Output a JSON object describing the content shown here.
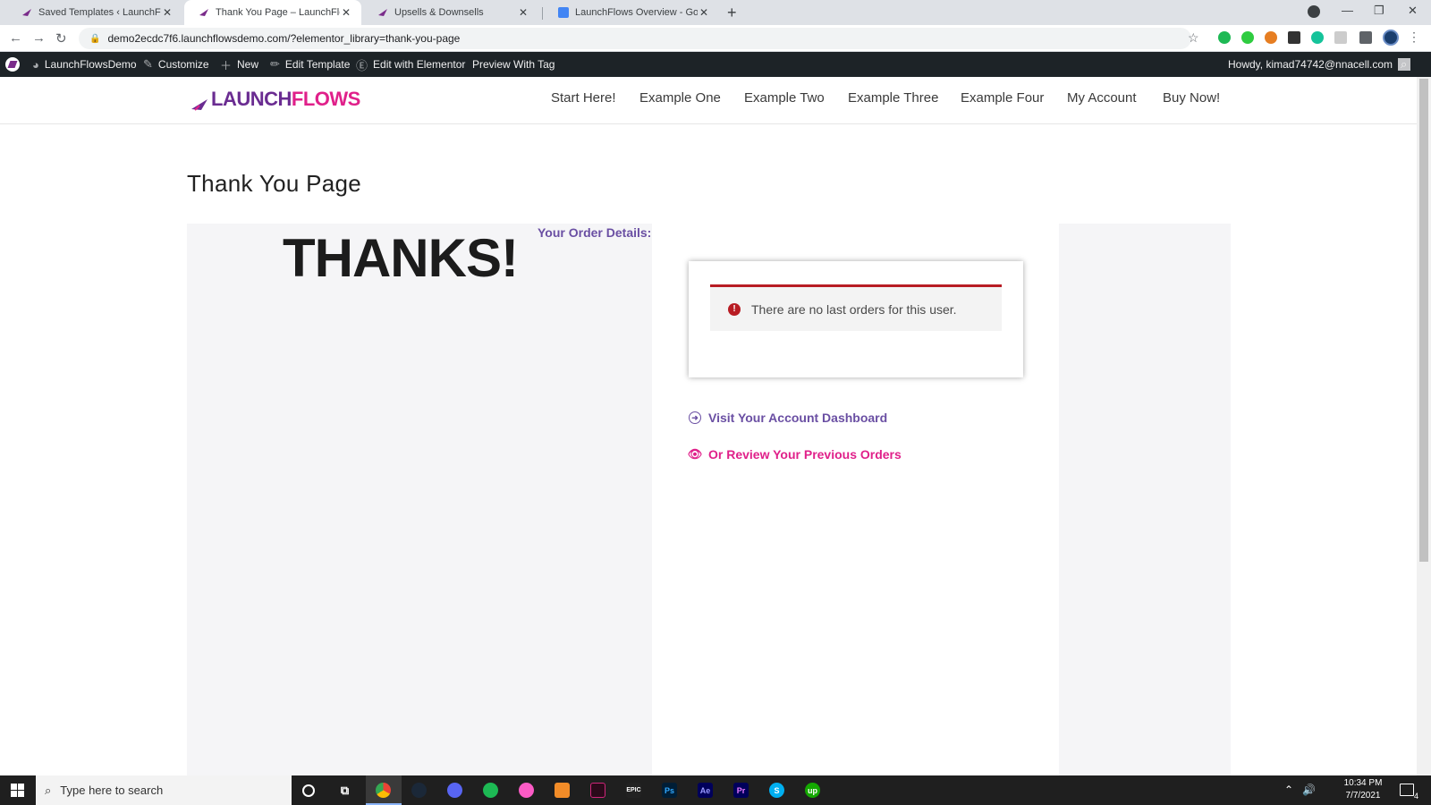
{
  "browser": {
    "tabs": [
      {
        "title": "Saved Templates ‹ LaunchFlowsD",
        "active": false
      },
      {
        "title": "Thank You Page – LaunchFlowsD",
        "active": true
      },
      {
        "title": "Upsells & Downsells",
        "active": false
      },
      {
        "title": "LaunchFlows Overview - Google",
        "active": false
      }
    ],
    "url": "demo2ecdc7f6.launchflowsdemo.com/?elementor_library=thank-you-page"
  },
  "wp_admin_bar": {
    "site_name": "LaunchFlowsDemo",
    "customize": "Customize",
    "new": "New",
    "edit_template": "Edit Template",
    "edit_elementor": "Edit with Elementor",
    "preview": "Preview With Tag",
    "howdy": "Howdy, kimad74742@nnacell.com"
  },
  "site": {
    "logo_part1": "LAUNCH",
    "logo_part2": "FLOWS",
    "nav": [
      "Start Here!",
      "Example One",
      "Example Two",
      "Example Three",
      "Example Four",
      "My Account",
      "Buy Now!"
    ]
  },
  "page": {
    "title": "Thank You Page",
    "thanks_heading": "THANKS!",
    "order_details_label": "Your Order Details:",
    "notice_text": "There are no last orders for this user.",
    "link_dashboard": "Visit Your Account Dashboard",
    "link_orders": "Or Review Your Previous Orders"
  },
  "taskbar": {
    "search_placeholder": "Type here to search",
    "time": "10:34 PM",
    "date": "7/7/2021",
    "notification_count": "4"
  },
  "colors": {
    "brand_purple": "#6a2c91",
    "brand_pink": "#e0208a",
    "error_red": "#b81c23"
  }
}
